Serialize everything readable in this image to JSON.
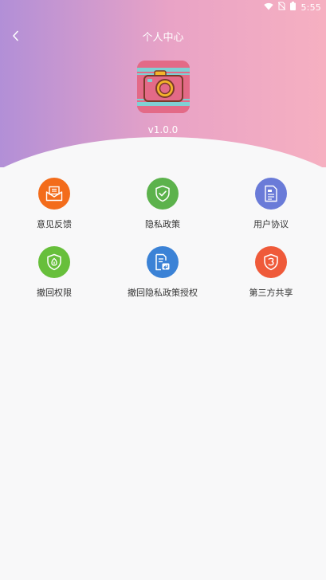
{
  "status_bar": {
    "time": "5:55",
    "icons": [
      "wifi-icon",
      "no-sim-icon",
      "battery-icon"
    ]
  },
  "header": {
    "title": "个人中心",
    "back_icon": "chevron-left-icon",
    "gradient": [
      "#b28fd7",
      "#e9a3c6",
      "#f6b0c1"
    ]
  },
  "app": {
    "logo_icon": "camera-icon",
    "version": "v1.0.0"
  },
  "menu": {
    "items": [
      {
        "label": "意见反馈",
        "icon": "envelope-icon",
        "color": "#f36c1b"
      },
      {
        "label": "隐私政策",
        "icon": "shield-check-icon",
        "color": "#5cb24c"
      },
      {
        "label": "用户协议",
        "icon": "document-icon",
        "color": "#6a7bd8"
      },
      {
        "label": "撤回权限",
        "icon": "shield-key-icon",
        "color": "#67bf3b"
      },
      {
        "label": "撤回隐私政策授权",
        "icon": "document-revoke-icon",
        "color": "#3b82d6"
      },
      {
        "label": "第三方共享",
        "icon": "shield-number-icon",
        "color": "#ef5a3a"
      }
    ]
  }
}
